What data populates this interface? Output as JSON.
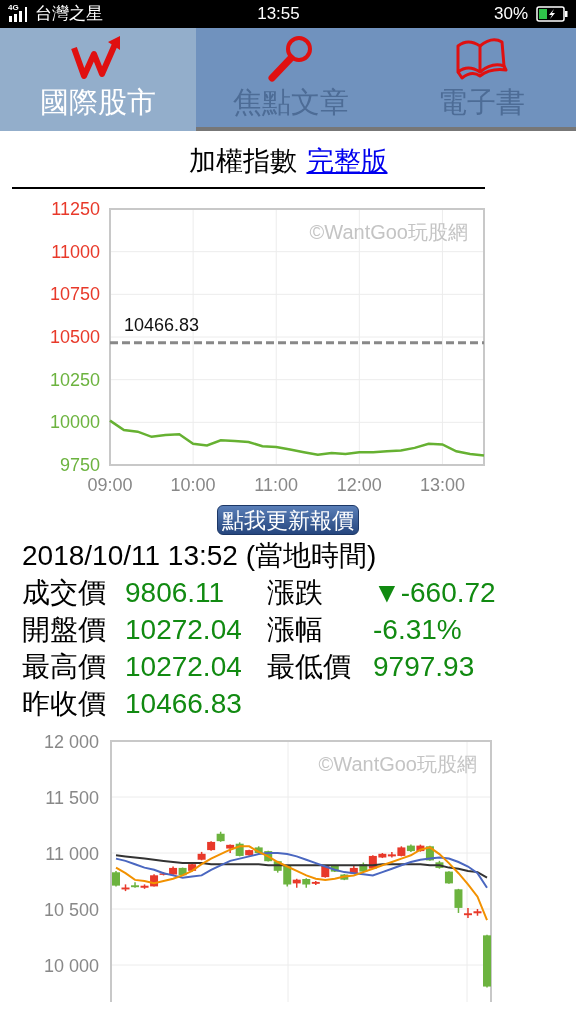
{
  "status_bar": {
    "network": "4G",
    "carrier": "台灣之星",
    "time": "13:55",
    "battery": "30%"
  },
  "tabs": [
    {
      "label": "國際股市",
      "selected": true
    },
    {
      "label": "焦點文章",
      "selected": false
    },
    {
      "label": "電子書",
      "selected": false
    }
  ],
  "heading": {
    "title": "加權指數",
    "link": "完整版"
  },
  "intraday_chart": {
    "watermark": "©WantGoo玩股網",
    "chart_data": {
      "type": "line",
      "ylim": [
        9750,
        11250
      ],
      "categories": [
        "09:00",
        null,
        null,
        null,
        null,
        null,
        "10:00",
        null,
        null,
        null,
        null,
        null,
        "11:00",
        null,
        null,
        null,
        null,
        null,
        "12:00",
        null,
        null,
        null,
        null,
        null,
        "13:00",
        null,
        null,
        null
      ],
      "yticks": [
        9750,
        10000,
        10250,
        10500,
        10750,
        11000,
        11250
      ],
      "series": [
        {
          "color": "#66b132",
          "values": [
            10010,
            9955,
            9945,
            9915,
            9925,
            9930,
            9875,
            9865,
            9895,
            9890,
            9885,
            9860,
            9855,
            9840,
            9825,
            9810,
            9820,
            9815,
            9825,
            9825,
            9830,
            9835,
            9850,
            9875,
            9870,
            9830,
            9815,
            9805
          ]
        }
      ],
      "grid": true,
      "ref_lines": [
        {
          "axis": "y",
          "value": 10466.83,
          "label": "10466.83"
        }
      ]
    }
  },
  "refresh_button": "點我更新報價",
  "quote": {
    "timestamp": "2018/10/11 13:52 (當地時間)",
    "rows": [
      [
        {
          "label": "成交價",
          "value": "9806.11"
        },
        {
          "label": "漲跌",
          "value": "▼-660.72"
        }
      ],
      [
        {
          "label": "開盤價",
          "value": "10272.04"
        },
        {
          "label": "漲幅",
          "value": "-6.31%"
        }
      ],
      [
        {
          "label": "最高價",
          "value": "10272.04"
        },
        {
          "label": "最低價",
          "value": "9797.93"
        }
      ],
      [
        {
          "label": "昨收價",
          "value": "10466.83"
        }
      ]
    ]
  },
  "candle_chart": {
    "watermark": "©WantGoo玩股網",
    "chart_data": {
      "type": "candlestick",
      "ylim": [
        9670,
        12000
      ],
      "yticks": [
        {
          "value": 12000,
          "label": "12 000"
        },
        {
          "value": 11500,
          "label": "11 500"
        },
        {
          "value": 11000,
          "label": "11 000"
        },
        {
          "value": 10500,
          "label": "10 500"
        },
        {
          "value": 10000,
          "label": "10 000"
        }
      ],
      "grid": true,
      "categories": [
        null,
        null,
        null,
        null,
        null,
        null,
        null,
        null,
        null,
        null,
        null,
        null,
        null,
        null,
        null,
        null,
        null,
        null,
        null,
        null,
        null,
        null,
        null,
        null,
        null,
        null,
        null,
        null,
        null,
        null,
        null,
        null,
        null,
        null,
        null,
        null,
        null,
        null,
        null,
        null
      ],
      "ohlc": [
        [
          10828,
          10840,
          10700,
          10709
        ],
        [
          10675,
          10720,
          10660,
          10692
        ],
        [
          10712,
          10740,
          10690,
          10695
        ],
        [
          10690,
          10720,
          10680,
          10708
        ],
        [
          10702,
          10810,
          10700,
          10801
        ],
        [
          10805,
          10830,
          10800,
          10818
        ],
        [
          10808,
          10880,
          10805,
          10867
        ],
        [
          10867,
          10870,
          10795,
          10801
        ],
        [
          10841,
          10915,
          10835,
          10900
        ],
        [
          10940,
          11010,
          10935,
          10993
        ],
        [
          11026,
          11105,
          11020,
          11099
        ],
        [
          11172,
          11190,
          11100,
          11106
        ],
        [
          11040,
          11075,
          11000,
          11073
        ],
        [
          11083,
          11095,
          10970,
          10974
        ],
        [
          10980,
          11030,
          10975,
          11026
        ],
        [
          11050,
          11060,
          10995,
          11000
        ],
        [
          11017,
          11020,
          10925,
          10927
        ],
        [
          10927,
          10930,
          10825,
          10841
        ],
        [
          10884,
          10890,
          10700,
          10719
        ],
        [
          10729,
          10770,
          10690,
          10762
        ],
        [
          10768,
          10775,
          10690,
          10719
        ],
        [
          10725,
          10750,
          10715,
          10742
        ],
        [
          10785,
          10890,
          10780,
          10884
        ],
        [
          10884,
          10890,
          10830,
          10834
        ],
        [
          10808,
          10812,
          10758,
          10762
        ],
        [
          10818,
          10885,
          10815,
          10867
        ],
        [
          10900,
          10915,
          10830,
          10834
        ],
        [
          10861,
          10980,
          10858,
          10974
        ],
        [
          10960,
          11000,
          10955,
          10993
        ],
        [
          10970,
          11010,
          10960,
          10988
        ],
        [
          10974,
          11060,
          10970,
          11050
        ],
        [
          11066,
          11075,
          11010,
          11017
        ],
        [
          11017,
          11075,
          11012,
          11066
        ],
        [
          11060,
          11065,
          10930,
          10934
        ],
        [
          10917,
          10930,
          10860,
          10867
        ],
        [
          10834,
          10838,
          10725,
          10729
        ],
        [
          10676,
          10680,
          10465,
          10510
        ],
        [
          10445,
          10510,
          10420,
          10462
        ],
        [
          10462,
          10500,
          10440,
          10480
        ],
        [
          10265,
          10270,
          9800,
          9808
        ]
      ],
      "series": [
        {
          "type": "line",
          "color": "#333333",
          "values": [
            10980,
            10970,
            10960,
            10950,
            10940,
            10930,
            10920,
            10910,
            10910,
            10910,
            10900,
            10900,
            10900,
            10900,
            10900,
            10900,
            10890,
            10890,
            10890,
            10890,
            10890,
            10890,
            10890,
            10890,
            10890,
            10890,
            10890,
            10890,
            10900,
            10900,
            10900,
            10900,
            10900,
            10890,
            10890,
            10870,
            10860,
            10840,
            10830,
            10780
          ]
        },
        {
          "type": "line",
          "color": "#4a67c0",
          "values": [
            10950,
            10930,
            10900,
            10870,
            10850,
            10820,
            10800,
            10780,
            10790,
            10800,
            10850,
            10890,
            10930,
            10950,
            10970,
            10990,
            11000,
            11000,
            10990,
            10970,
            10940,
            10910,
            10880,
            10850,
            10830,
            10820,
            10810,
            10800,
            10830,
            10860,
            10890,
            10920,
            10940,
            10950,
            10960,
            10950,
            10920,
            10880,
            10820,
            10690
          ]
        },
        {
          "type": "line",
          "color": "#f29100",
          "values": [
            10870,
            10820,
            10760,
            10750,
            10730,
            10750,
            10770,
            10800,
            10840,
            10900,
            10950,
            10990,
            11030,
            11060,
            11060,
            11010,
            10970,
            10920,
            10880,
            10840,
            10800,
            10770,
            10760,
            10770,
            10790,
            10800,
            10830,
            10860,
            10890,
            10920,
            10950,
            10980,
            11030,
            11050,
            10990,
            10910,
            10820,
            10720,
            10610,
            10400
          ]
        }
      ]
    }
  }
}
